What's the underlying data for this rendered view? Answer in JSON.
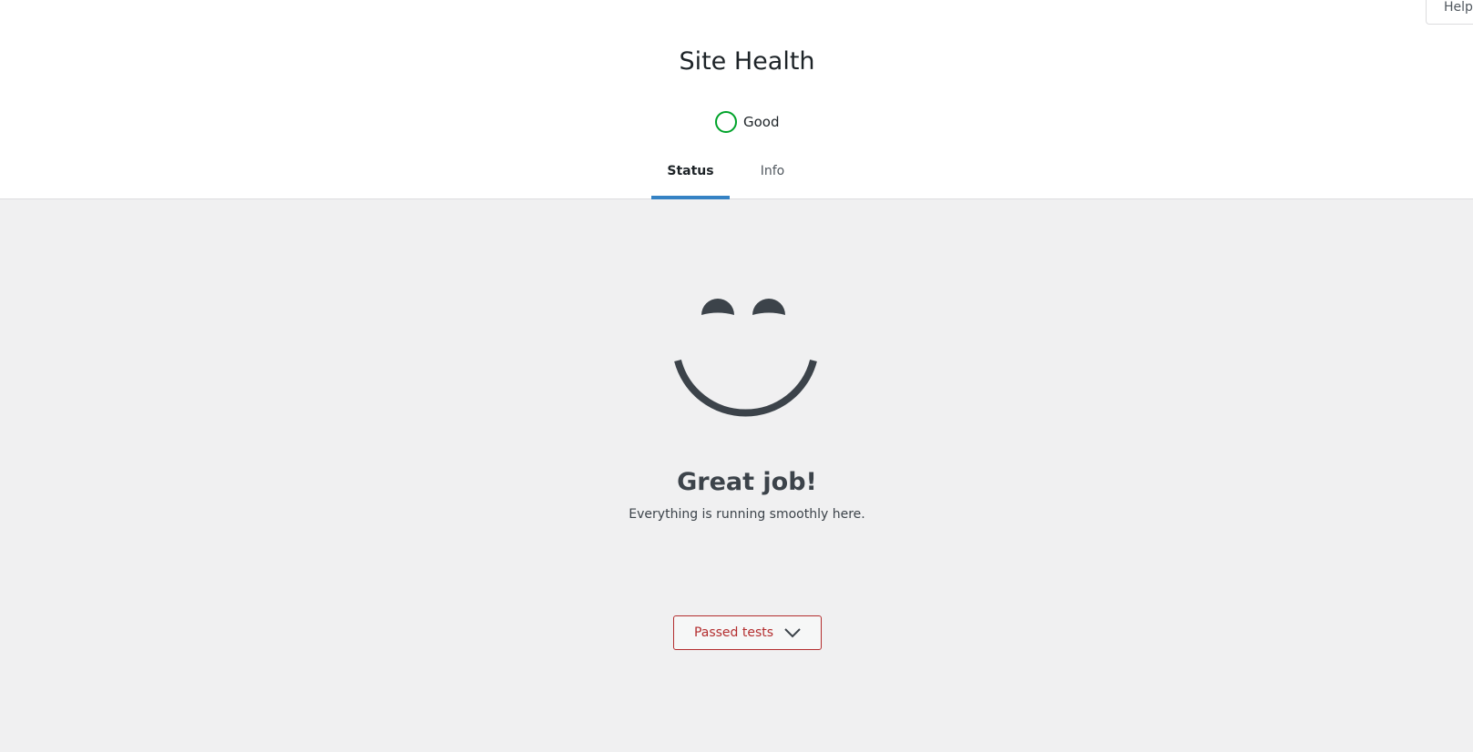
{
  "help_tab": {
    "label": "Help"
  },
  "page": {
    "title": "Site Health"
  },
  "health_status": {
    "label": "Good",
    "color": "#00a32a"
  },
  "tabs": [
    {
      "label": "Status",
      "active": true
    },
    {
      "label": "Info",
      "active": false
    }
  ],
  "result": {
    "heading": "Great job!",
    "message": "Everything is running smoothly here."
  },
  "passed_tests": {
    "label": "Passed tests"
  },
  "colors": {
    "accent": "#3582c4",
    "good": "#00a32a",
    "button_text": "#b32d2e",
    "smiley": "#3c434a"
  }
}
